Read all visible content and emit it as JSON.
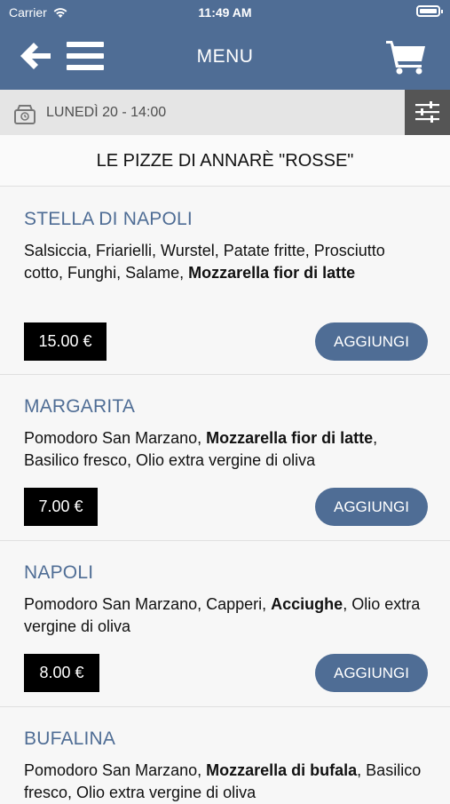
{
  "status_bar": {
    "carrier": "Carrier",
    "time": "11:49 AM"
  },
  "header": {
    "title": "MENU"
  },
  "date_bar": {
    "label": "LUNEDÌ 20 - 14:00"
  },
  "section": {
    "title": "LE PIZZE DI ANNARÈ \"ROSSE\""
  },
  "items": [
    {
      "name": "STELLA DI NAPOLI",
      "desc_plain": "Salsiccia, Friarielli, Wurstel, Patate fritte, Prosciutto cotto, Funghi, Salame, ",
      "desc_bold": "Mozzarella fior di latte",
      "desc_after": "",
      "price": "15.00 €",
      "add_label": "AGGIUNGI"
    },
    {
      "name": "MARGARITA",
      "desc_plain": "Pomodoro San Marzano, ",
      "desc_bold": "Mozzarella fior di latte",
      "desc_after": ", Basilico fresco, Olio extra vergine di oliva",
      "price": "7.00 €",
      "add_label": "AGGIUNGI"
    },
    {
      "name": "NAPOLI",
      "desc_plain": "Pomodoro San Marzano, Capperi, ",
      "desc_bold": "Acciughe",
      "desc_after": ", Olio extra vergine di oliva",
      "price": "8.00 €",
      "add_label": "AGGIUNGI"
    },
    {
      "name": "BUFALINA",
      "desc_plain": "Pomodoro San Marzano, ",
      "desc_bold": "Mozzarella di bufala",
      "desc_after": ", Basilico fresco, Olio extra vergine di oliva",
      "price": "",
      "add_label": ""
    }
  ],
  "colors": {
    "header_bg": "#4f6d95",
    "accent": "#4f6d95",
    "price_bg": "#000000"
  }
}
